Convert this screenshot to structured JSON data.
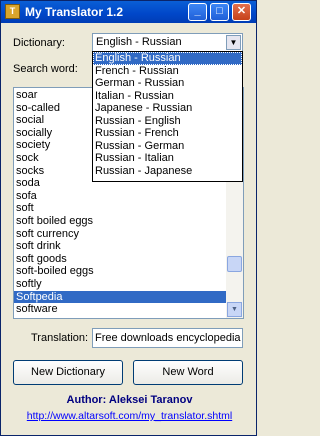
{
  "window": {
    "title": "My Translator 1.2",
    "icon": "translator-app-icon",
    "controls": {
      "minimize": "_",
      "maximize": "□",
      "close": "✕"
    }
  },
  "dictionary": {
    "label": "Dictionary:",
    "selected": "English - Russian",
    "options": [
      "English - Russian",
      "French - Russian",
      "German - Russian",
      "Italian - Russian",
      "Japanese - Russian",
      "Russian - English",
      "Russian - French",
      "Russian - German",
      "Russian - Italian",
      "Russian - Japanese"
    ],
    "highlighted_index": 0
  },
  "search": {
    "label": "Search word:",
    "value": ""
  },
  "word_list": {
    "items": [
      "soar",
      "so-called",
      "social",
      "socially",
      "society",
      "sock",
      "socks",
      "soda",
      "sofa",
      "soft",
      "soft boiled eggs",
      "soft currency",
      "soft drink",
      "soft goods",
      "soft-boiled eggs",
      "softly",
      "Softpedia",
      "software"
    ],
    "selected_index": 16
  },
  "translation": {
    "label": "Translation:",
    "value": "Free downloads encyclopedia"
  },
  "buttons": {
    "new_dictionary": "New Dictionary",
    "new_word": "New Word"
  },
  "footer": {
    "author": "Author: Aleksei Taranov",
    "link": "http://www.altarsoft.com/my_translator.shtml"
  }
}
